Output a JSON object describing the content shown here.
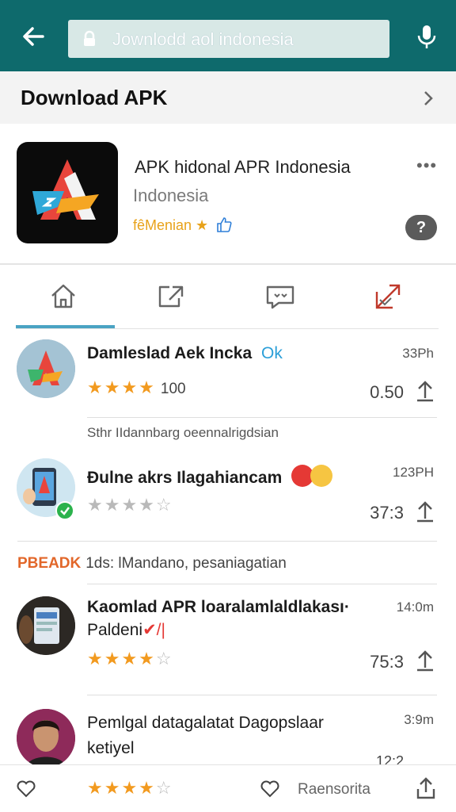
{
  "topbar": {
    "search_query": "Jownlodd aol indonesia",
    "icons": [
      "back-arrow-icon",
      "lock-icon",
      "mic-icon"
    ],
    "color": "#0e6a6c"
  },
  "section": {
    "title": "Download APK"
  },
  "app": {
    "title": "APK hidonal APR Indonesia",
    "subtitle": "Indonesia",
    "rating_label": "fêMenian ★",
    "more": "•••",
    "help": "?"
  },
  "tabs": [
    {
      "icon": "home-icon"
    },
    {
      "icon": "share-box-icon"
    },
    {
      "icon": "chat-icon"
    },
    {
      "icon": "trending-icon"
    }
  ],
  "items": [
    {
      "title": "Damleslad Aek Incka",
      "tag": "Ok",
      "time": "33Ph",
      "rating": 4,
      "count": "100",
      "value": "0.50"
    },
    {
      "title": "Đulne akrs Ilagahiancam",
      "time": "123PH",
      "rating": 0,
      "value": "37:3"
    },
    {
      "title": "Kaomlad APR loaralamlaldlakası·",
      "title2": "Paldeni",
      "title2_mark": "✔/|",
      "time": "14:0m",
      "rating": 4,
      "value": "75:3"
    },
    {
      "title": "Pemlgal datagalatat Dagopslaar",
      "title2": "ketiyel",
      "time": "3:9m",
      "value": "12:2"
    }
  ],
  "notes": {
    "note1": "Sthr IIdannbarg oeennalrigdsian",
    "banner_brand": "PBEADK",
    "banner_text": "1ds: lMandano, pesaniagatian"
  },
  "bottombar": {
    "rating": 4,
    "label": "Raensorita"
  },
  "colors": {
    "accent": "#4aa3c3",
    "star": "#f29a1f",
    "banner": "#e2672a"
  }
}
